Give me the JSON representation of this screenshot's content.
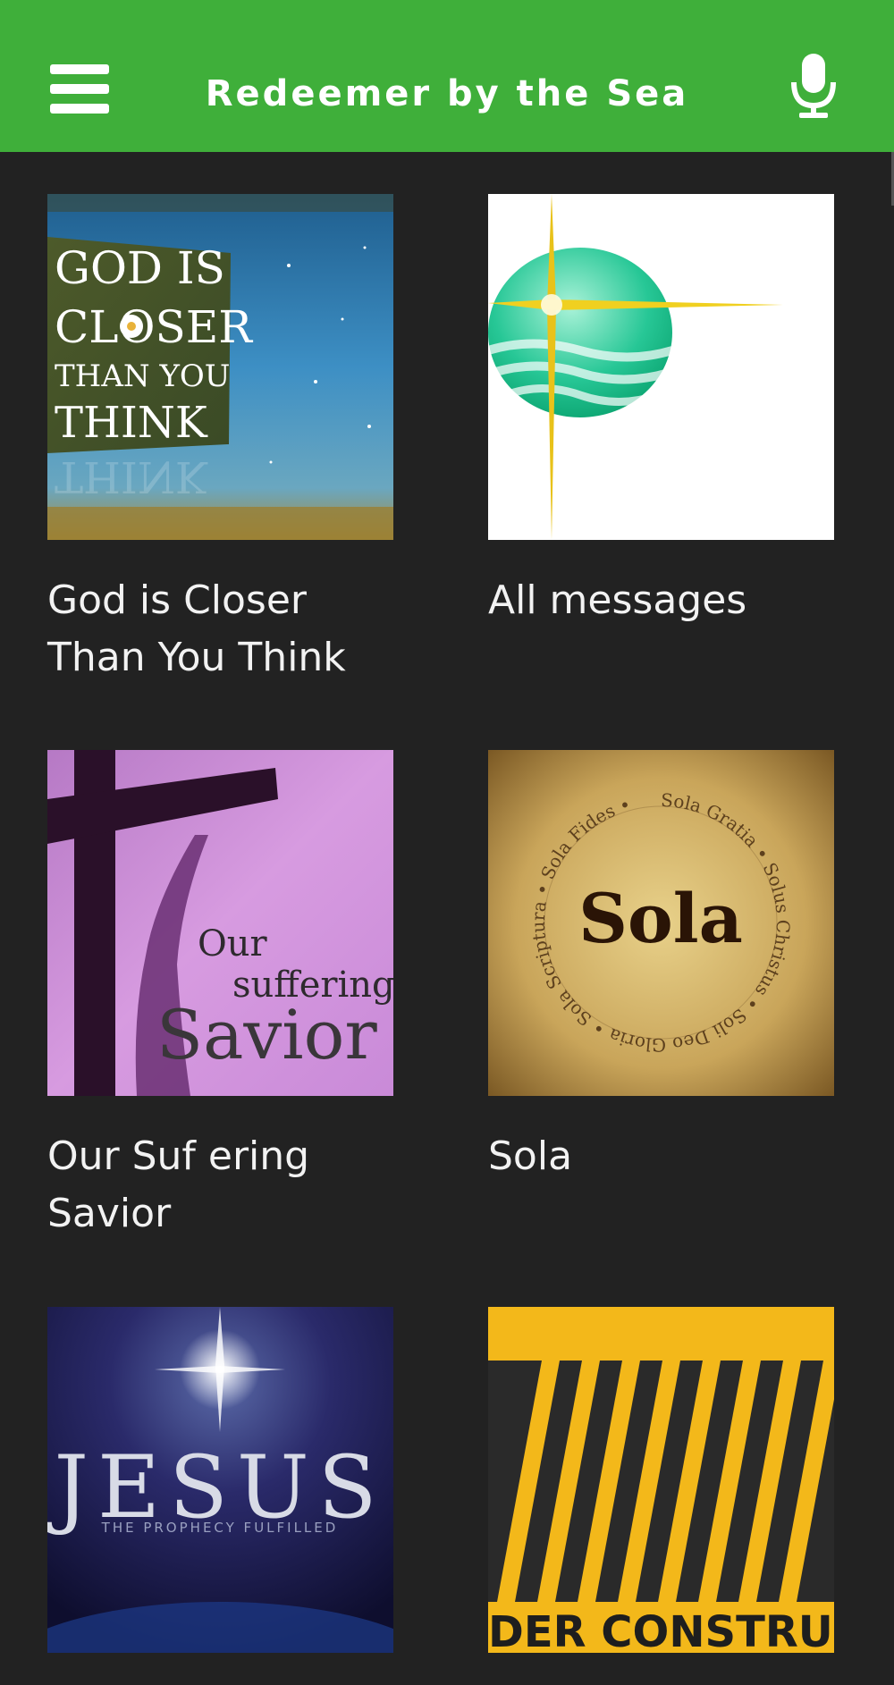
{
  "header": {
    "title": "Redeemer by the Sea",
    "menu_icon": "hamburger-menu-icon",
    "mic_icon": "microphone-icon",
    "color": "#3faf3a"
  },
  "grid": {
    "items": [
      {
        "label": "God is Closer Than You Think",
        "art_text": [
          "GOD IS",
          "CLOSER",
          "THAN YOU",
          "THINK"
        ]
      },
      {
        "label": "All messages"
      },
      {
        "label": "Our Suf ering Savior",
        "art_text": [
          "Our",
          "suffering",
          "Savior"
        ]
      },
      {
        "label": "Sola",
        "art_text": [
          "Sola",
          "Sola Gratia",
          "Solus Christus",
          "Soli Deo Gloria",
          "Sola Scriptura",
          "Sola Fides"
        ]
      },
      {
        "label": "",
        "art_text": [
          "JESUS",
          "THE PROPHECY FULFILLED"
        ]
      },
      {
        "label": "",
        "art_text": [
          "DER CONSTRUCTI"
        ]
      }
    ]
  },
  "colors": {
    "background": "#222222",
    "text": "#f2f2f2"
  }
}
